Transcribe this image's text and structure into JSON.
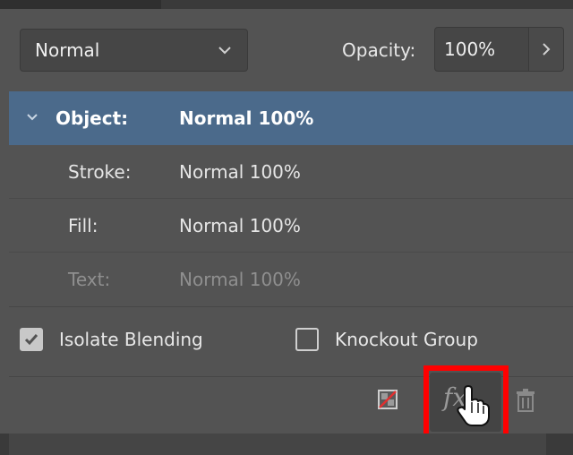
{
  "blend": {
    "mode": "Normal",
    "opacity_label": "Opacity:",
    "opacity_value": "100%"
  },
  "effects": {
    "object": {
      "label": "Object:",
      "value": "Normal 100%"
    },
    "stroke": {
      "label": "Stroke:",
      "value": "Normal 100%"
    },
    "fill": {
      "label": "Fill:",
      "value": "Normal 100%"
    },
    "text": {
      "label": "Text:",
      "value": "Normal 100%"
    }
  },
  "options": {
    "isolate_blending": {
      "label": "Isolate Blending",
      "checked": true
    },
    "knockout_group": {
      "label": "Knockout Group",
      "checked": false
    }
  },
  "toolbar": {
    "clear_icon": "clear-effects-icon",
    "fx_icon": "fx-icon",
    "trash_icon": "trash-icon"
  },
  "colors": {
    "panel": "#535353",
    "selected_row": "#4b6a8b",
    "highlight": "#ff0000"
  }
}
